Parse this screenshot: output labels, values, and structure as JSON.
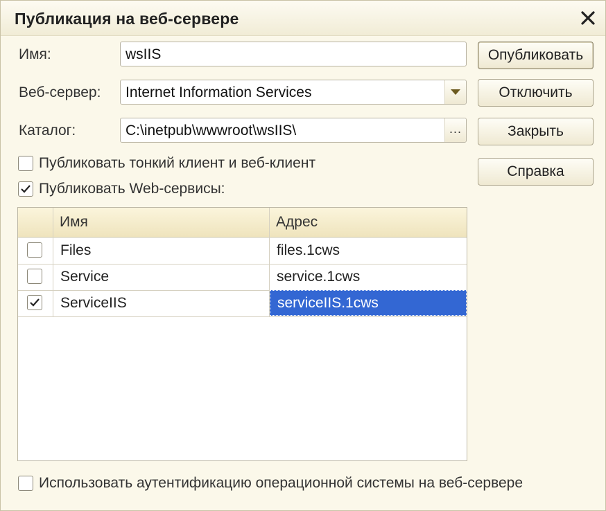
{
  "window": {
    "title": "Публикация на веб-сервере"
  },
  "fields": {
    "name_label": "Имя:",
    "name_value": "wsIIS",
    "server_label": "Веб-сервер:",
    "server_value": "Internet Information Services",
    "catalog_label": "Каталог:",
    "catalog_value": "C:\\inetpub\\wwwroot\\wsIIS\\",
    "catalog_browse": "..."
  },
  "buttons": {
    "publish": "Опубликовать",
    "disable": "Отключить",
    "close": "Закрыть",
    "help": "Справка"
  },
  "options": {
    "thin_client": {
      "label": "Публиковать тонкий клиент и веб-клиент",
      "checked": false
    },
    "web_services": {
      "label": "Публиковать Web-сервисы:",
      "checked": true
    },
    "os_auth": {
      "label": "Использовать аутентификацию операционной системы на веб-сервере",
      "checked": false
    }
  },
  "services_table": {
    "columns": [
      "Имя",
      "Адрес"
    ],
    "rows": [
      {
        "checked": false,
        "name": "Files",
        "address": "files.1cws",
        "selected": false
      },
      {
        "checked": false,
        "name": "Service",
        "address": "service.1cws",
        "selected": false
      },
      {
        "checked": true,
        "name": "ServiceIIS",
        "address": "serviceIIS.1cws",
        "selected": true
      }
    ]
  },
  "colors": {
    "background": "#fbf8ea",
    "selection": "#3367d3",
    "header_bg": "#efe4bd"
  }
}
